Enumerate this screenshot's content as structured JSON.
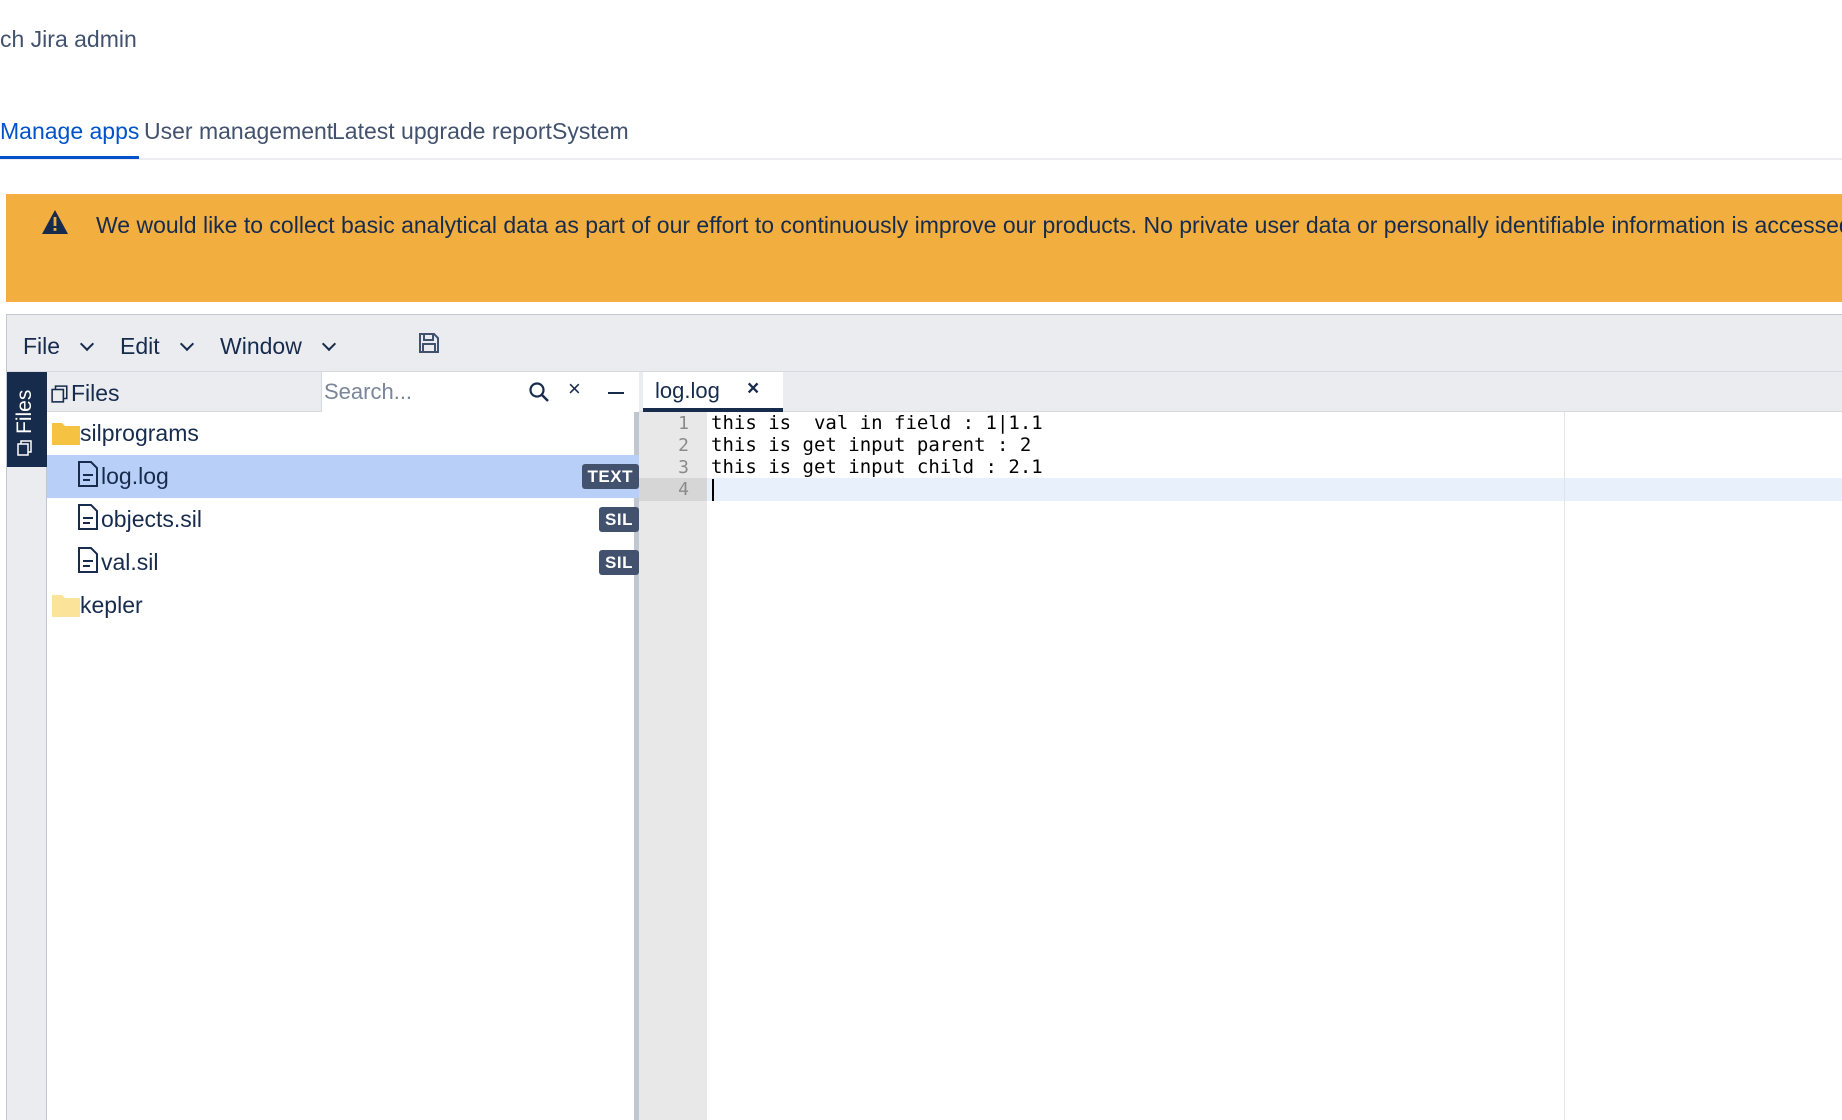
{
  "page": {
    "header_title": "ch Jira admin"
  },
  "tabs": [
    {
      "label": "Manage apps",
      "active": true
    },
    {
      "label": "User management",
      "active": false
    },
    {
      "label": "Latest upgrade report",
      "active": false
    },
    {
      "label": "System",
      "active": false
    }
  ],
  "banner": {
    "icon": "warning-icon",
    "message": "We would like to collect basic analytical data as part of our effort to continuously improve our products. No private user data or personally identifiable information is accessed",
    "color": "#f2ae3e"
  },
  "toolbar": {
    "menus": [
      "File",
      "Edit",
      "Window"
    ],
    "save_icon": "save-icon"
  },
  "side_rail": {
    "label": "Files"
  },
  "files_panel": {
    "title": "Files",
    "search_placeholder": "Search...",
    "clear_label": "×",
    "tree": [
      {
        "name": "silprograms",
        "type": "folder",
        "open": true
      },
      {
        "name": "log.log",
        "type": "file",
        "badge": "TEXT",
        "selected": true
      },
      {
        "name": "objects.sil",
        "type": "file",
        "badge": "SIL",
        "selected": false
      },
      {
        "name": "val.sil",
        "type": "file",
        "badge": "SIL",
        "selected": false
      },
      {
        "name": "kepler",
        "type": "folder",
        "open": false
      }
    ]
  },
  "editor": {
    "tab": {
      "name": "log.log",
      "close_label": "×"
    },
    "line_numbers": [
      "1",
      "2",
      "3",
      "4"
    ],
    "lines": [
      "this is  val in field : 1|1.1",
      "this is get input parent : 2",
      "this is get input child : 2.1",
      ""
    ],
    "active_line": 4
  }
}
